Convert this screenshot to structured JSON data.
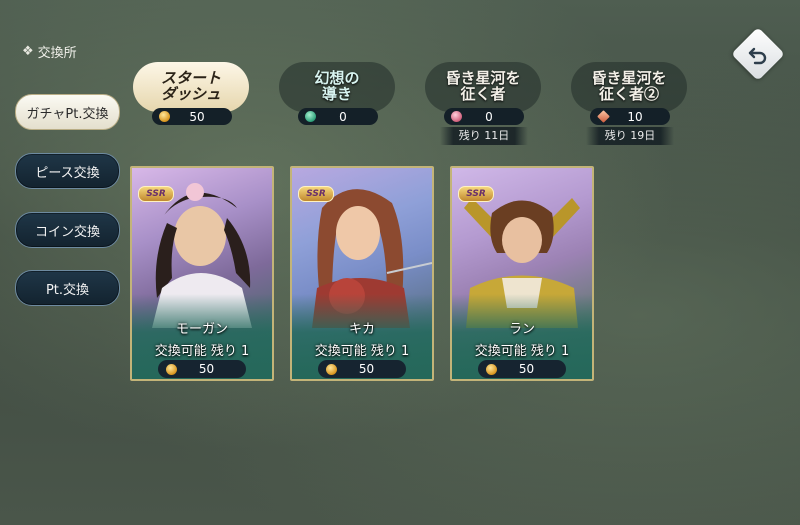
{
  "header": {
    "title": "交換所",
    "title_icon": "gear-flower-icon"
  },
  "back_button": {
    "icon": "back-arrow-icon"
  },
  "sidebar": {
    "items": [
      {
        "label": "ガチャPt.交換",
        "active": true
      },
      {
        "label": "ピース交換",
        "active": false
      },
      {
        "label": "コイン交換",
        "active": false
      },
      {
        "label": "Pt.交換",
        "active": false
      }
    ]
  },
  "currencies": [
    {
      "logo": "スタート\nダッシュ",
      "value": "50",
      "coin": "gold",
      "style": "gold",
      "remaining": ""
    },
    {
      "logo": "幻想の\n導き",
      "value": "0",
      "coin": "green",
      "style": "dark",
      "remaining": ""
    },
    {
      "logo": "昏き星河を\n征く者",
      "value": "0",
      "coin": "pink",
      "style": "dark",
      "remaining": "残り 11日"
    },
    {
      "logo": "昏き星河を\n征く者②",
      "value": "10",
      "coin": "diamond",
      "style": "dark",
      "remaining": "残り 19日"
    }
  ],
  "cards": [
    {
      "rarity": "SSR",
      "name": "モーガン",
      "status": "交換可能 残り 1",
      "price": "50"
    },
    {
      "rarity": "SSR",
      "name": "キカ",
      "status": "交換可能 残り 1",
      "price": "50"
    },
    {
      "rarity": "SSR",
      "name": "ラン",
      "status": "交換可能 残り 1",
      "price": "50"
    }
  ],
  "colors": {
    "accent_gold": "#c3b478",
    "panel_dark": "#142028",
    "background": "#4a564a"
  }
}
